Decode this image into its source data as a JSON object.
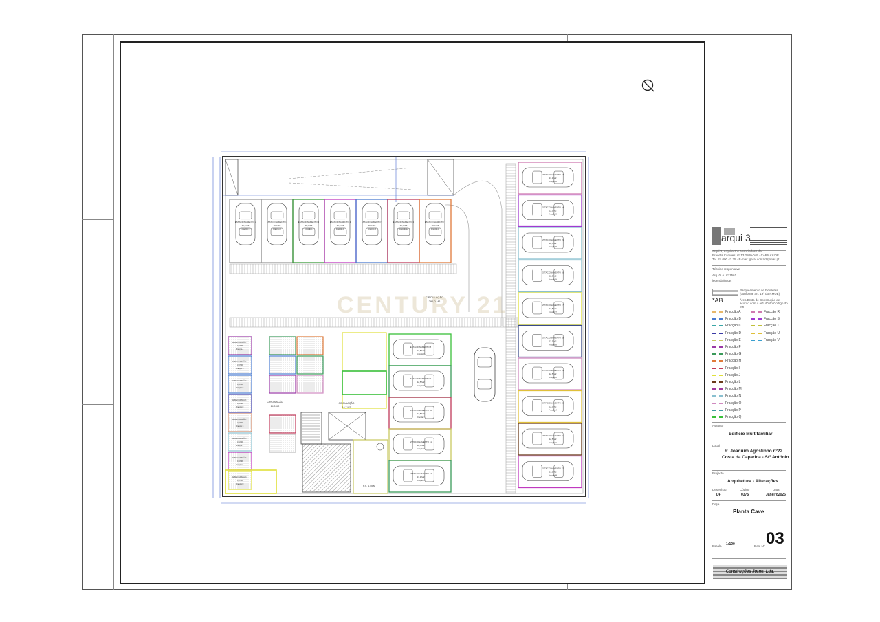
{
  "title_block": {
    "firm_logo_text": "arqui 3",
    "firm_name": "Arqui 3, Arquitectos Associados Lda.",
    "firm_address": "Praceta Camões, nº 13 2800-049 · CARNAXIDE",
    "firm_contact": "Tel. 21 000 41 25 · E-mail: geral.contact@mail.pt",
    "technical_label": "Técnico responsável",
    "technical_value": "Arq. O.A. nº 1561",
    "legend_title": "legenda/notas",
    "note_parking": "Parqueamento de bicicletas (conforme art. 19º do RMUE)",
    "note_ab_symbol": "*AB",
    "note_ab": "Área Bruta de Construção de acordo com o artº 40 do Código do IMI",
    "legend_items": [
      {
        "label": "Fracção A",
        "color": "#e8b86a"
      },
      {
        "label": "Fracção B",
        "color": "#4a7bd0"
      },
      {
        "label": "Fracção C",
        "color": "#3aa6a6"
      },
      {
        "label": "Fracção D",
        "color": "#3a3aa6"
      },
      {
        "label": "Fracção E",
        "color": "#c8c860"
      },
      {
        "label": "Fracção F",
        "color": "#9a3aa6"
      },
      {
        "label": "Fracção G",
        "color": "#3a9a5a"
      },
      {
        "label": "Fracção H",
        "color": "#e07a3a"
      },
      {
        "label": "Fracção I",
        "color": "#c03a5a"
      },
      {
        "label": "Fracção J",
        "color": "#e0e03a"
      },
      {
        "label": "Fracção L",
        "color": "#6a3a1a"
      },
      {
        "label": "Fracção M",
        "color": "#a03aa0"
      },
      {
        "label": "Fracção N",
        "color": "#8ac0d0"
      },
      {
        "label": "Fracção O",
        "color": "#d08ac0"
      },
      {
        "label": "Fracção P",
        "color": "#3a9aa0"
      },
      {
        "label": "Fracção Q",
        "color": "#3ac03a"
      }
    ],
    "legend_items_right": [
      {
        "label": "Fracção R",
        "color": "#d07ab0"
      },
      {
        "label": "Fracção S",
        "color": "#a03ad0"
      },
      {
        "label": "Fracção T",
        "color": "#c0c03a"
      },
      {
        "label": "Fracção U",
        "color": "#e0c03a"
      },
      {
        "label": "Fracção V",
        "color": "#3aa0d0"
      }
    ],
    "assunto_label": "Assunto",
    "assunto_value": "Edifício Multifamiliar",
    "local_label": "Local",
    "local_line1": "R. Joaquim Agostinho nº22",
    "local_line2": "Costa da Caparica - Stº António",
    "projecto_label": "Projecto",
    "projecto_value": "Arquitetura - Alterações",
    "desenhou_label": "Desenhou",
    "desenhou_value": "DF",
    "codigo_label": "Código",
    "codigo_value": "0375",
    "data_label": "Data",
    "data_value": "Janeiro2025",
    "peca_label": "Peça",
    "peca_value": "Planta Cave",
    "escala_label": "Escala",
    "escala_value": "1:100",
    "des_label": "Des. Nº",
    "des_value": "03",
    "contractor": "Construções Jorne, Lda."
  },
  "watermark": "CENTURY 21",
  "plan": {
    "circulation_label": "CIRCULAÇÃO",
    "circulation_area": "295,0 M2",
    "top_row": [
      {
        "name": "ESTACIONAMENTO 1",
        "area": "12,5 M2",
        "frac": "Fracção I",
        "color": "#9a9a9a"
      },
      {
        "name": "ESTACIONAMENTO 2",
        "area": "12,5 M2",
        "frac": "Fracção J",
        "color": "#9a9a9a"
      },
      {
        "name": "ESTACIONAMENTO 3",
        "area": "12,5 M2",
        "frac": "Fracção L",
        "color": "#3a9a3a"
      },
      {
        "name": "ESTACIONAMENTO 4",
        "area": "12,5 M2",
        "frac": "Fracção D",
        "color": "#c03ac0"
      },
      {
        "name": "ESTACIONAMENTO 5",
        "area": "12,5 M2",
        "frac": "Fracção B",
        "color": "#4a7bd0"
      },
      {
        "name": "ESTACIONAMENTO 6",
        "area": "12,5 M2",
        "frac": "Fracção E",
        "color": "#c03a5a"
      },
      {
        "name": "ESTACIONAMENTO 7",
        "area": "12,5 M2",
        "frac": "Fracção H",
        "color": "#e07a3a"
      }
    ],
    "right_col": [
      {
        "name": "ESTACIONAMENTO 13",
        "area": "13,1 M2",
        "frac": "Fracção R",
        "color": "#d07ab0"
      },
      {
        "name": "ESTACIONAMENTO 14",
        "area": "12,5 M2",
        "frac": "Fracção S",
        "color": "#a03ad0"
      },
      {
        "name": "ESTACIONAMENTO 15",
        "area": "12,5 M2",
        "frac": "Fracção P",
        "color": "#8ac0d0"
      },
      {
        "name": "ESTACIONAMENTO 16",
        "area": "12,5 M2",
        "frac": "Fracção N",
        "color": "#8ac0d0"
      },
      {
        "name": "ESTACIONAMENTO 17",
        "area": "17,5 M2",
        "frac": "Fracção T",
        "color": "#e0e03a"
      },
      {
        "name": "ESTACIONAMENTO 18",
        "area": "13,5 M2",
        "frac": "Fracção B",
        "color": "#3a4a8a"
      },
      {
        "name": "ESTACIONAMENTO 19",
        "area": "12,5 M2",
        "frac": "Fracção O",
        "color": "#d08ac0"
      },
      {
        "name": "ESTACIONAMENTO 20",
        "area": "12,5 M2",
        "frac": "Fracção J",
        "color": "#e0c03a"
      },
      {
        "name": "ESTACIONAMENTO 21",
        "area": "12,5 M2",
        "frac": "Fracção U",
        "color": "#6a3a1a"
      },
      {
        "name": "ESTACIONAMENTO 22",
        "area": "13,5 M2",
        "frac": "Fracção M",
        "color": "#c03ac0"
      }
    ],
    "mid_col": [
      {
        "name": "ESTACIONAMENTO 8",
        "area": "13,8 M2",
        "frac": "Fracção Q",
        "color": "#3ac03a"
      },
      {
        "name": "ESTACIONAMENTO 9",
        "area": "12,5 M2",
        "frac": "Fracção G",
        "color": "#3a9a5a"
      },
      {
        "name": "ESTACIONAMENTO 10",
        "area": "12,5 M2",
        "frac": "Fracção I",
        "color": "#c03a5a"
      },
      {
        "name": "ESTACIONAMENTO 11",
        "area": "12,5 M2",
        "frac": "Fracção C",
        "color": "#c8c860"
      },
      {
        "name": "ESTACIONAMENTO 12",
        "area": "13,1 M2",
        "frac": "Fracção V",
        "color": "#3a9a5a"
      }
    ],
    "storage": [
      {
        "name": "ARRECADAÇÃO 1",
        "area": "3,6 M2",
        "frac": "Fracção A"
      },
      {
        "name": "ARRECADAÇÃO 2",
        "area": "3,6 M2",
        "frac": "Fracção B"
      },
      {
        "name": "ARRECADAÇÃO 3",
        "area": "3,6 M2",
        "frac": "Fracção C"
      },
      {
        "name": "ARRECADAÇÃO 4",
        "area": "3,6 M2",
        "frac": "Fracção D"
      },
      {
        "name": "ARRECADAÇÃO 5",
        "area": "3,6 M2",
        "frac": "Fracção E"
      },
      {
        "name": "ARRECADAÇÃO 6",
        "area": "3,6 M2",
        "frac": "Fracção F"
      },
      {
        "name": "ARRECADAÇÃO 7",
        "area": "3,6 M2",
        "frac": "Fracção G"
      },
      {
        "name": "ARRECADAÇÃO 8",
        "area": "3,6 M2",
        "frac": "Fracção H"
      }
    ],
    "circ2_label": "CIRCULAÇÃO",
    "circ2_area": "14,8 M2",
    "circ3_label": "CIRCULAÇÃO",
    "circ3_area": "16,7 M2",
    "ps_label": "P.S. 1,45 M"
  }
}
